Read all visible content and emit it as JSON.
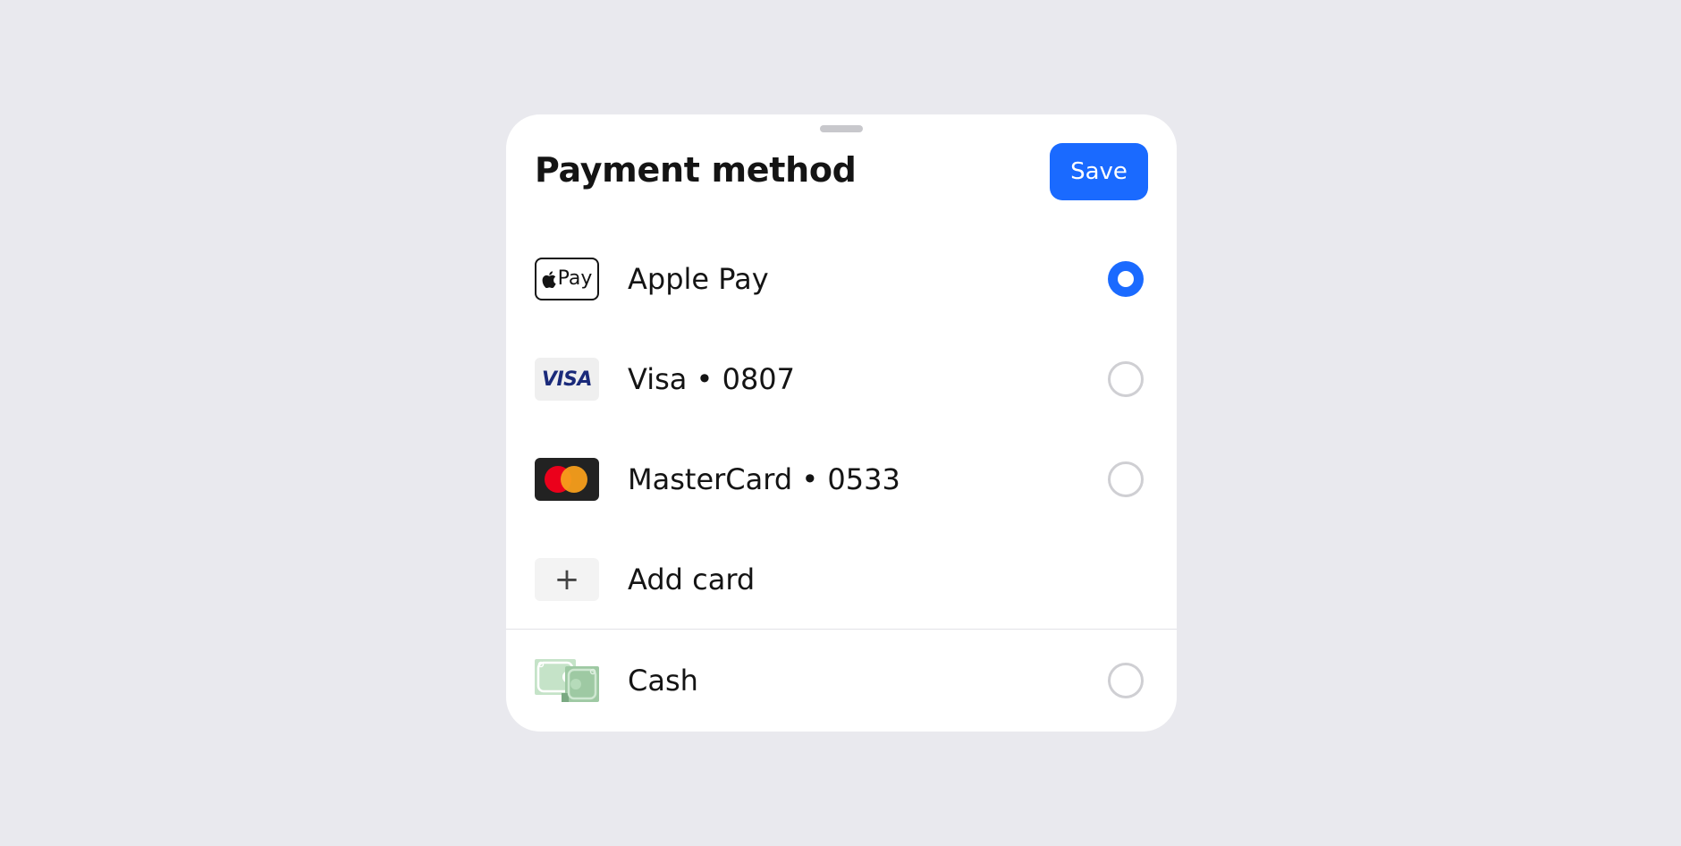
{
  "sheet": {
    "title": "Payment method",
    "save_label": "Save"
  },
  "methods": [
    {
      "label": "Apple Pay",
      "icon": "apple-pay-icon",
      "icon_text": "Pay",
      "selected": true
    },
    {
      "label": "Visa • 0807",
      "icon": "visa-icon",
      "icon_text": "VISA",
      "selected": false
    },
    {
      "label": "MasterCard • 0533",
      "icon": "mastercard-icon",
      "selected": false
    },
    {
      "label": "Add card",
      "icon": "plus-icon",
      "icon_text": "+"
    },
    {
      "label": "Cash",
      "icon": "cash-icon",
      "selected": false
    }
  ],
  "colors": {
    "accent": "#1a6aff",
    "background": "#e9e9ee",
    "sheet": "#ffffff"
  }
}
